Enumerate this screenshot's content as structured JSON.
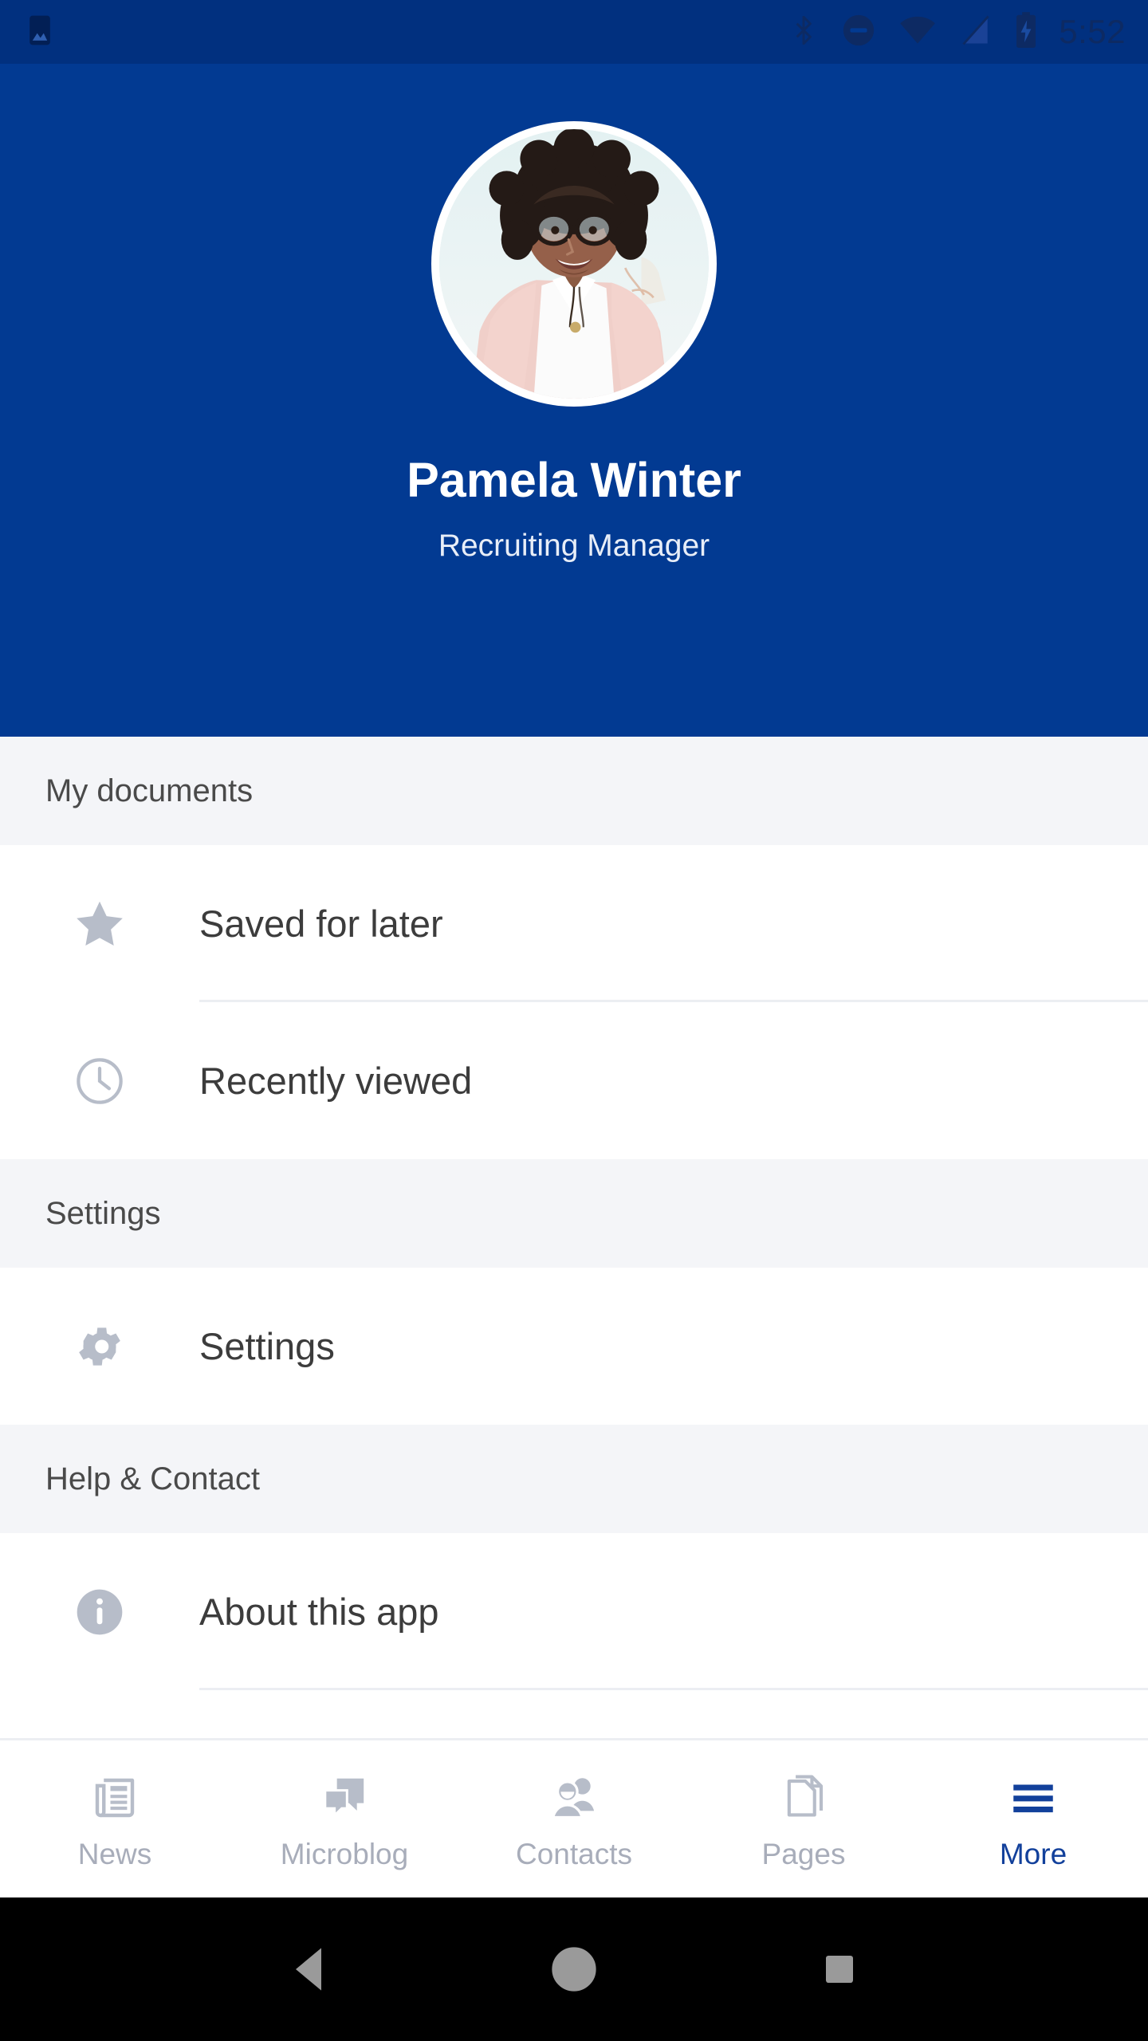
{
  "status_bar": {
    "time": "5:52",
    "icons": [
      "image-notification-icon",
      "bluetooth-icon",
      "do-not-disturb-icon",
      "wifi-icon",
      "cellular-signal-off-icon",
      "battery-charging-icon"
    ],
    "background_color": "#01307f"
  },
  "profile": {
    "name": "Pamela Winter",
    "role": "Recruiting Manager",
    "avatar_alt": "user-avatar-photo",
    "background_color": "#023a92"
  },
  "sections": [
    {
      "title": "My documents",
      "items": [
        {
          "label": "Saved for later",
          "icon": "star-icon"
        },
        {
          "label": "Recently viewed",
          "icon": "clock-icon"
        }
      ]
    },
    {
      "title": "Settings",
      "items": [
        {
          "label": "Settings",
          "icon": "gear-icon"
        }
      ]
    },
    {
      "title": "Help & Contact",
      "items": [
        {
          "label": "About this app",
          "icon": "info-icon"
        }
      ]
    }
  ],
  "bottom_nav": {
    "active_color": "#12409b",
    "inactive_color": "#a8adba",
    "items": [
      {
        "label": "News",
        "icon": "newspaper-icon",
        "active": false
      },
      {
        "label": "Microblog",
        "icon": "chat-bubbles-icon",
        "active": false
      },
      {
        "label": "Contacts",
        "icon": "people-icon",
        "active": false
      },
      {
        "label": "Pages",
        "icon": "documents-icon",
        "active": false
      },
      {
        "label": "More",
        "icon": "hamburger-menu-icon",
        "active": true
      }
    ]
  },
  "system_nav": {
    "back": "back-triangle",
    "home": "home-circle",
    "recents": "recents-square"
  }
}
